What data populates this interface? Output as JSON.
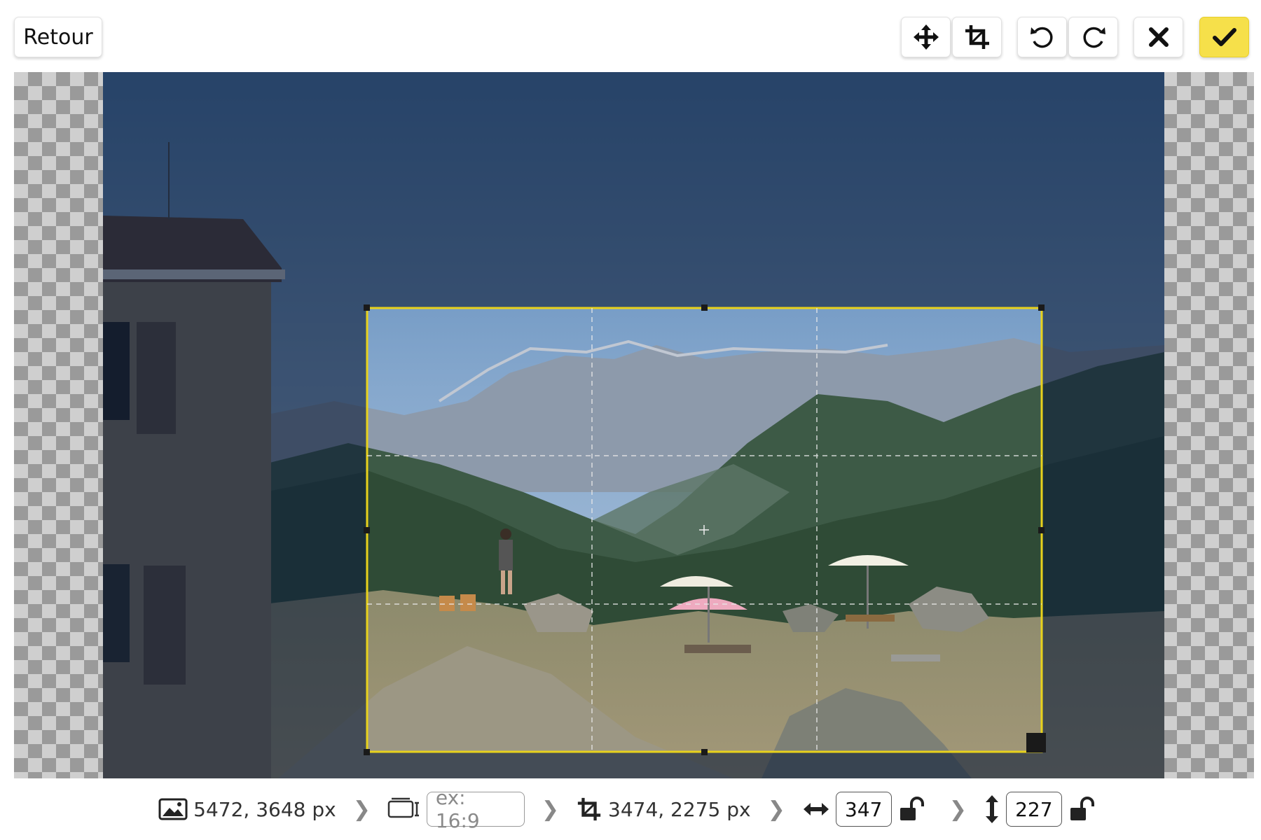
{
  "toolbar": {
    "back_label": "Retour",
    "icons": [
      "move-icon",
      "crop-icon",
      "rotate-left-icon",
      "rotate-right-icon",
      "close-icon",
      "check-icon"
    ],
    "confirm_color": "#f6e04a"
  },
  "crop": {
    "frame_color": "#e8d21c"
  },
  "status": {
    "image_size": "5472, 3648 px",
    "ratio_placeholder": "ex: 16:9",
    "crop_size": "3474, 2275 px",
    "width_value": "347",
    "height_value": "227"
  }
}
